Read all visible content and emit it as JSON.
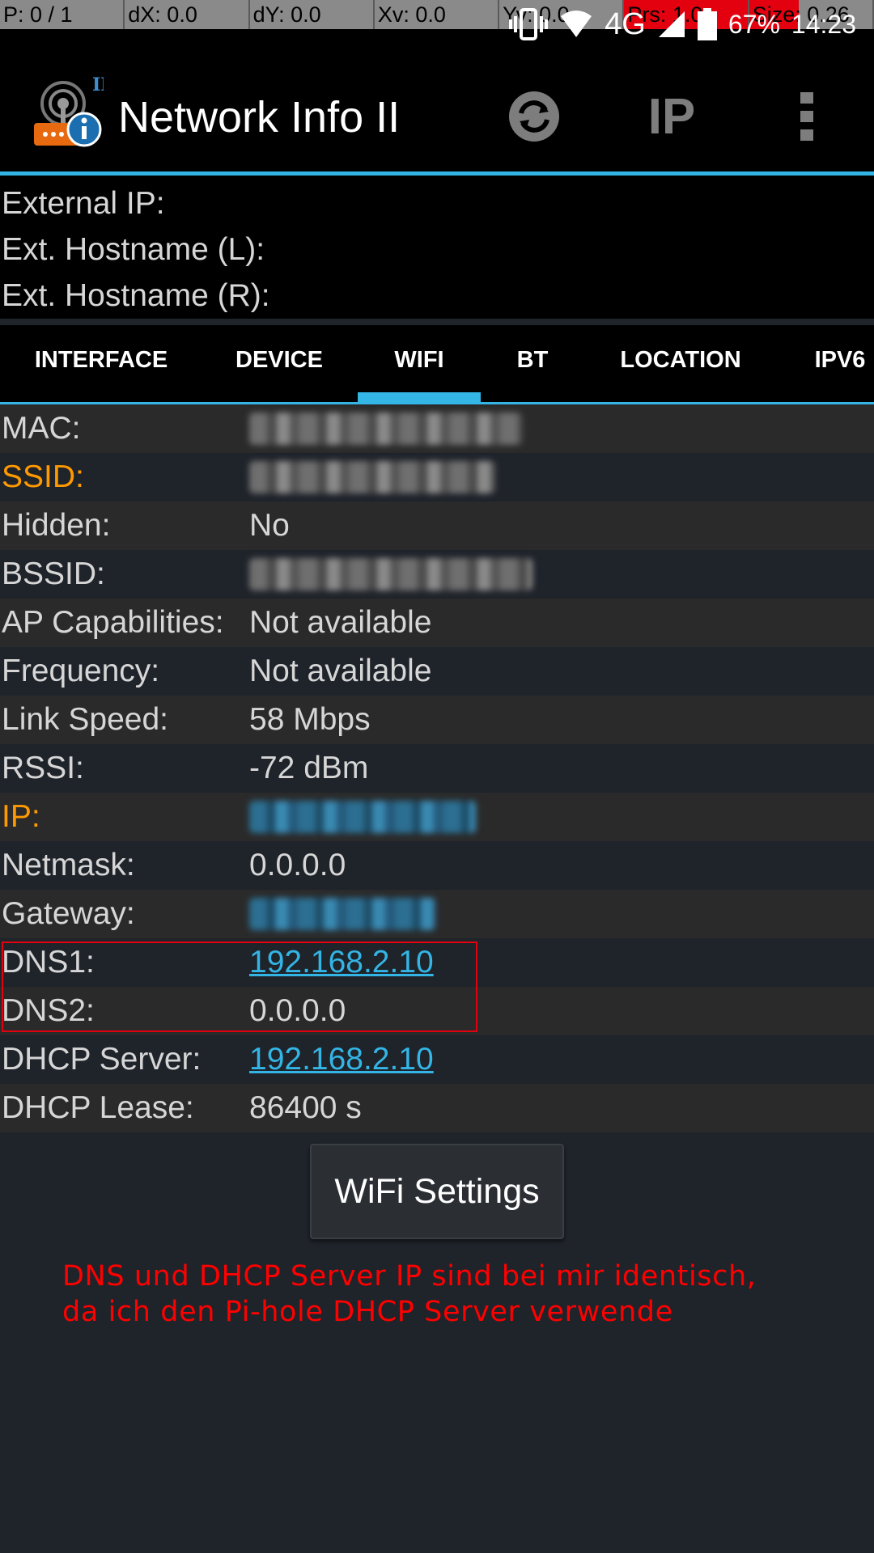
{
  "pointer_bar": {
    "cells": [
      "P: 0 / 1",
      "dX: 0.0",
      "dY: 0.0",
      "Xv: 0.0",
      "Yv: 0.0",
      "Prs: 1.0",
      "Size: 0.26"
    ]
  },
  "status_bar": {
    "network": "4G",
    "battery": "67%",
    "time": "14:23",
    "icons": [
      "vibrate-icon",
      "wifi-signal-icon",
      "cell-signal-icon",
      "battery-icon"
    ]
  },
  "toolbar": {
    "title": "Network Info II",
    "ip_label": "IP",
    "icons": [
      "app-logo-icon",
      "refresh-icon",
      "overflow-menu-icon"
    ]
  },
  "external": {
    "ip_label": "External IP:",
    "hostname_l_label": "Ext. Hostname (L):",
    "hostname_r_label": "Ext. Hostname (R):"
  },
  "tabs": [
    {
      "label": "INTERFACE"
    },
    {
      "label": "DEVICE"
    },
    {
      "label": "WIFI"
    },
    {
      "label": "BT"
    },
    {
      "label": "LOCATION"
    },
    {
      "label": "IPV6"
    }
  ],
  "active_tab": "WIFI",
  "wifi_info": {
    "mac": {
      "label": "MAC:"
    },
    "ssid": {
      "label": "SSID:"
    },
    "hidden": {
      "label": "Hidden:",
      "value": "No"
    },
    "bssid": {
      "label": "BSSID:"
    },
    "ap_capabilities": {
      "label": "AP Capabilities:",
      "value": "Not available"
    },
    "frequency": {
      "label": "Frequency:",
      "value": "Not available"
    },
    "link_speed": {
      "label": "Link Speed:",
      "value": "58 Mbps"
    },
    "rssi": {
      "label": "RSSI:",
      "value": "-72 dBm"
    },
    "ip": {
      "label": "IP:"
    },
    "netmask": {
      "label": "Netmask:",
      "value": "0.0.0.0"
    },
    "gateway": {
      "label": "Gateway:"
    },
    "dns1": {
      "label": "DNS1:",
      "value": "192.168.2.10"
    },
    "dns2": {
      "label": "DNS2:",
      "value": "0.0.0.0"
    },
    "dhcp_server": {
      "label": "DHCP Server:",
      "value": "192.168.2.10"
    },
    "dhcp_lease": {
      "label": "DHCP Lease:",
      "value": "86400 s"
    }
  },
  "wifi_settings_button": "WiFi Settings",
  "annotation": {
    "line1": "DNS und DHCP Server IP sind bei mir identisch,",
    "line2": "da ich den Pi-hole DHCP Server verwende",
    "color": "#ff0000"
  },
  "colors": {
    "accent": "#33b5e5",
    "highlight_label": "#ff9900",
    "annotation_red": "#ff0000"
  }
}
